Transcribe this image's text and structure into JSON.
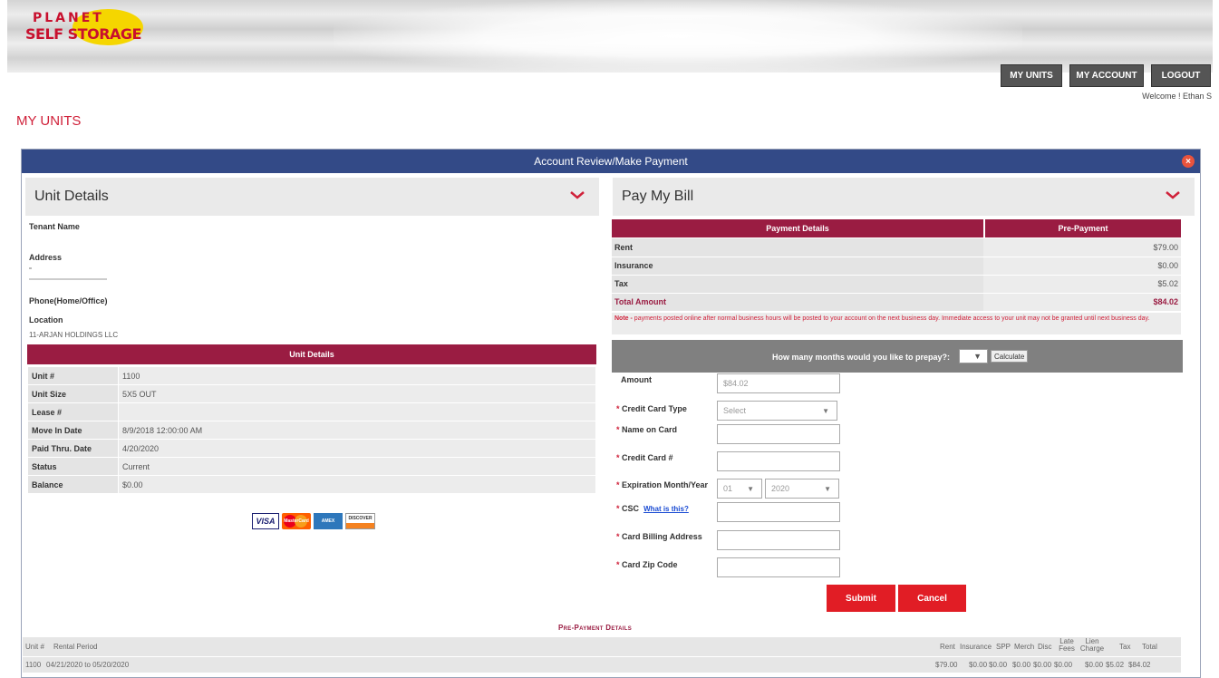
{
  "header": {
    "logo_line1": "PLANET",
    "logo_line2": "SELF STORAGE",
    "nav": [
      "MY UNITS",
      "MY ACCOUNT",
      "LOGOUT"
    ],
    "welcome": "Welcome ! Ethan S"
  },
  "page_title": "MY UNITS",
  "modal": {
    "title": "Account Review/Make Payment",
    "close_symbol": "×"
  },
  "unit_details": {
    "section_title": "Unit Details",
    "tenant_name_label": "Tenant Name",
    "address_label": "Address",
    "phone_label": "Phone(Home/Office)",
    "location_label": "Location",
    "location_value": "11-ARJAN HOLDINGS LLC",
    "table_header": "Unit Details",
    "rows": [
      {
        "label": "Unit #",
        "value": "1100"
      },
      {
        "label": "Unit Size",
        "value": "5X5 OUT"
      },
      {
        "label": "Lease #",
        "value": ""
      },
      {
        "label": "Move In Date",
        "value": "8/9/2018 12:00:00 AM"
      },
      {
        "label": "Paid Thru. Date",
        "value": "4/20/2020"
      },
      {
        "label": "Status",
        "value": "Current"
      },
      {
        "label": "Balance",
        "value": "$0.00"
      }
    ],
    "card_logos": [
      "VISA",
      "MasterCard",
      "AMEX",
      "DISCOVER"
    ]
  },
  "pay_bill": {
    "section_title": "Pay My Bill",
    "col_headers": [
      "Payment Details",
      "Pre-Payment"
    ],
    "rows": [
      {
        "label": "Rent",
        "value": "$79.00"
      },
      {
        "label": "Insurance",
        "value": "$0.00"
      },
      {
        "label": "Tax",
        "value": "$5.02"
      },
      {
        "label": "Total Amount",
        "value": "$84.02"
      }
    ],
    "note_prefix": "Note -",
    "note_text": "payments posted online after normal business hours will be posted to your account on the next business day. Immediate access to your unit may not be granted until next business day.",
    "prepay_question": "How many months would you like to prepay?:",
    "calculate_label": "Calculate",
    "form": {
      "amount_label": "Amount",
      "amount_value": "$84.02",
      "card_type_label": "Credit Card Type",
      "card_type_value": "Select",
      "name_label": "Name on  Card",
      "card_number_label": "Credit Card #",
      "expiration_label": "Expiration Month/Year",
      "exp_month": "01",
      "exp_year": "2020",
      "csc_label": "CSC",
      "csc_link": "What is this?",
      "billing_address_label": "Card Billing Address",
      "zip_label": "Card Zip Code",
      "required_mark": "*"
    },
    "submit_label": "Submit",
    "cancel_label": "Cancel"
  },
  "prepayment_details": {
    "title": "Pre-Payment Details",
    "headers": [
      "Unit #",
      "Rental Period",
      "Rent",
      "Insurance",
      "SPP",
      "Merch",
      "Disc",
      "Late Fees",
      "Lien Charge",
      "Tax",
      "Total"
    ],
    "rows": [
      [
        "1100",
        "04/21/2020 to 05/20/2020",
        "$79.00",
        "$0.00",
        "$0.00",
        "$0.00",
        "$0.00",
        "$0.00",
        "$0.00",
        "$5.02",
        "$84.02"
      ]
    ]
  },
  "colors": {
    "accent_red": "#d0213a",
    "maroon": "#9a1c42",
    "modal_header": "#334a87",
    "button_red": "#e11d25"
  }
}
